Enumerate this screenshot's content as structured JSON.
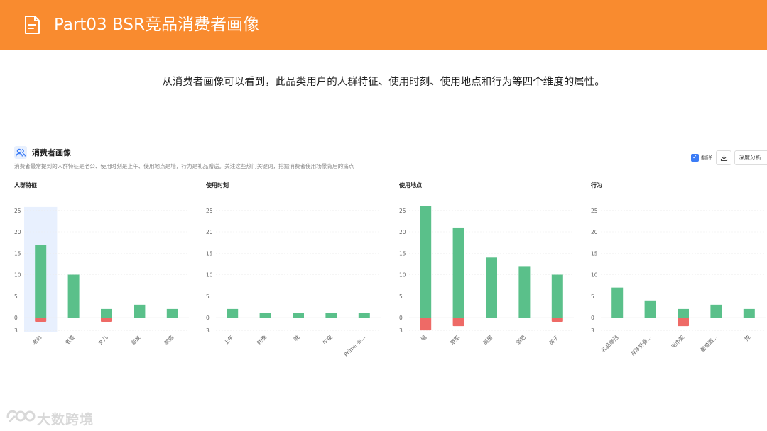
{
  "header": {
    "title": "Part03 BSR竞品消费者画像"
  },
  "intro": {
    "text": "从消费者画像可以看到，此品类用户的人群特征、使用时刻、使用地点和行为等四个维度的属性。"
  },
  "panel": {
    "title": "消费者画像",
    "description": "消费者最常提到的人群特征是老公、使用时刻是上午、使用地点是墙，行为是礼品赠送。关注这些热门关键词，挖掘消费者使用场景背后的痛点"
  },
  "toolbar": {
    "translate_label": "翻译",
    "deep_label": "深度分析"
  },
  "colors": {
    "header": "#f98b2f",
    "positive": "#5ac08a",
    "negative": "#ee6a66",
    "highlight": "#e8f0fe"
  },
  "watermark": {
    "text": "大数跨境"
  },
  "chart_data": [
    {
      "type": "bar",
      "title": "人群特征",
      "categories": [
        "老公",
        "老婆",
        "女儿",
        "朋友",
        "家庭"
      ],
      "series": [
        {
          "values": [
            17,
            10,
            2,
            3,
            2
          ]
        },
        {
          "values": [
            1,
            0,
            1,
            0,
            0
          ]
        }
      ],
      "yticks": [
        "25",
        "20",
        "15",
        "10",
        "5",
        "0",
        "3"
      ],
      "highlight_index": 0
    },
    {
      "type": "bar",
      "title": "使用时刻",
      "categories": [
        "上午",
        "晚晚",
        "晚",
        "午夜",
        "Prime 会..."
      ],
      "series": [
        {
          "values": [
            2,
            1,
            1,
            1,
            1
          ]
        },
        {
          "values": [
            0,
            0,
            0,
            0,
            0
          ]
        }
      ],
      "yticks": [
        "25",
        "20",
        "15",
        "10",
        "5",
        "0",
        "3"
      ]
    },
    {
      "type": "bar",
      "title": "使用地点",
      "categories": [
        "墙",
        "浴室",
        "厨房",
        "酒吧",
        "房子"
      ],
      "series": [
        {
          "values": [
            26,
            21,
            14,
            12,
            10
          ]
        },
        {
          "values": [
            3,
            2,
            0,
            0,
            1
          ]
        }
      ],
      "yticks": [
        "25",
        "20",
        "15",
        "10",
        "5",
        "0",
        "3"
      ]
    },
    {
      "type": "bar",
      "title": "行为",
      "categories": [
        "礼品赠送",
        "存放折叠...",
        "毛巾架",
        "葡萄酒...",
        "挂"
      ],
      "series": [
        {
          "values": [
            7,
            4,
            2,
            3,
            2
          ]
        },
        {
          "values": [
            0,
            0,
            2,
            0,
            0
          ]
        }
      ],
      "yticks": [
        "25",
        "20",
        "15",
        "10",
        "5",
        "0",
        "3"
      ]
    }
  ]
}
